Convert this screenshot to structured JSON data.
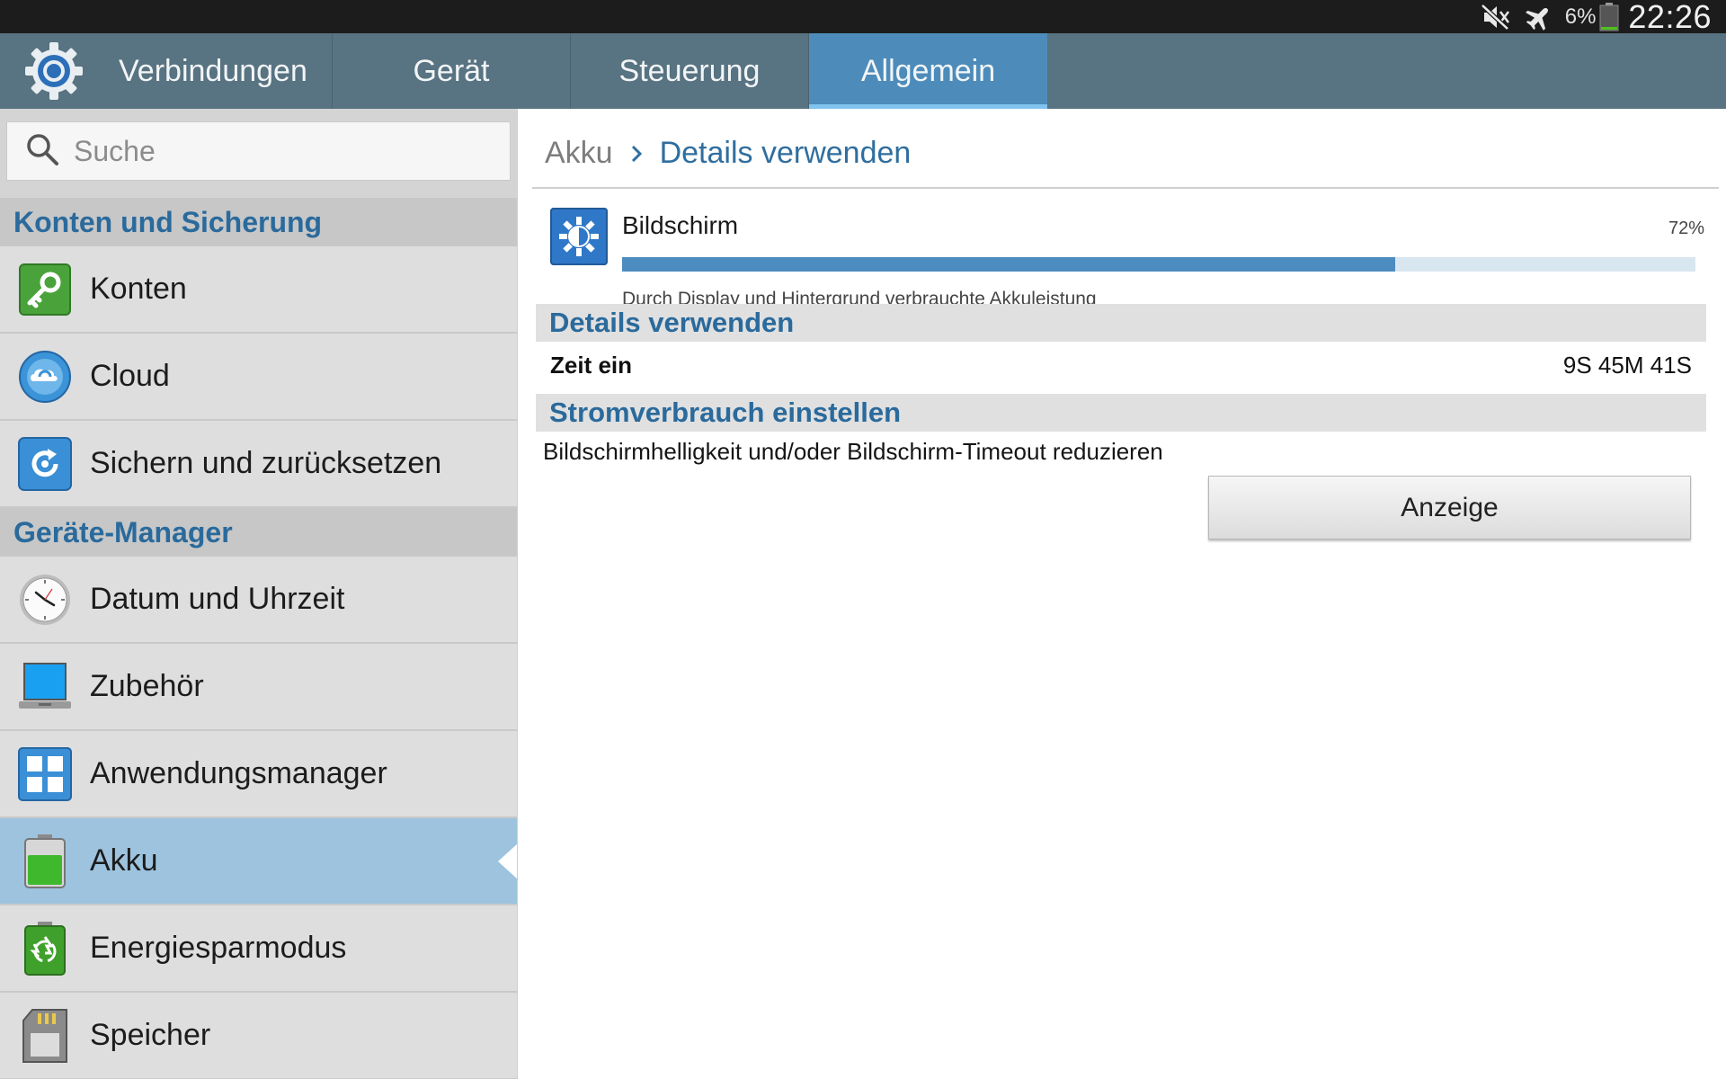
{
  "status_bar": {
    "battery_percent": "6%",
    "clock": "22:26",
    "icons": [
      "mute-icon",
      "airplane-mode-icon",
      "battery-icon"
    ]
  },
  "tabs": [
    {
      "label": "Verbindungen"
    },
    {
      "label": "Gerät"
    },
    {
      "label": "Steuerung"
    },
    {
      "label": "Allgemein",
      "selected": true
    }
  ],
  "sidebar": {
    "search_placeholder": "Suche",
    "sections": [
      {
        "header": "Konten und Sicherung",
        "items": [
          {
            "label": "Konten",
            "icon": "key-icon"
          },
          {
            "label": "Cloud",
            "icon": "cloud-icon"
          },
          {
            "label": "Sichern und zurücksetzen",
            "icon": "backup-restore-icon"
          }
        ]
      },
      {
        "header": "Geräte-Manager",
        "items": [
          {
            "label": "Datum und Uhrzeit",
            "icon": "clock-icon"
          },
          {
            "label": "Zubehör",
            "icon": "accessory-icon"
          },
          {
            "label": "Anwendungsmanager",
            "icon": "app-manager-icon"
          },
          {
            "label": "Akku",
            "icon": "battery-icon",
            "selected": true
          },
          {
            "label": "Energiesparmodus",
            "icon": "power-saving-icon"
          },
          {
            "label": "Speicher",
            "icon": "storage-icon"
          }
        ]
      }
    ]
  },
  "content": {
    "breadcrumb_parent": "Akku",
    "breadcrumb_current": "Details verwenden",
    "usage": {
      "name": "Bildschirm",
      "percent_label": "72%",
      "percent_value": 0.72,
      "description": "Durch Display und Hintergrund verbrauchte Akkuleistung",
      "icon": "brightness-icon"
    },
    "details_header": "Details verwenden",
    "time_on_label": "Zeit ein",
    "time_on_value": "9S 45M 41S",
    "adjust_header": "Stromverbrauch einstellen",
    "adjust_description": "Bildschirmhelligkeit und/oder Bildschirm-Timeout reduzieren",
    "display_button": "Anzeige"
  },
  "colors": {
    "tab_bar": "#587381",
    "tab_selected": "#4d8cba",
    "section_header_text": "#2a6a9c",
    "sidebar_selected": "#9dc3de",
    "usage_bar": "#4d8cc0"
  }
}
